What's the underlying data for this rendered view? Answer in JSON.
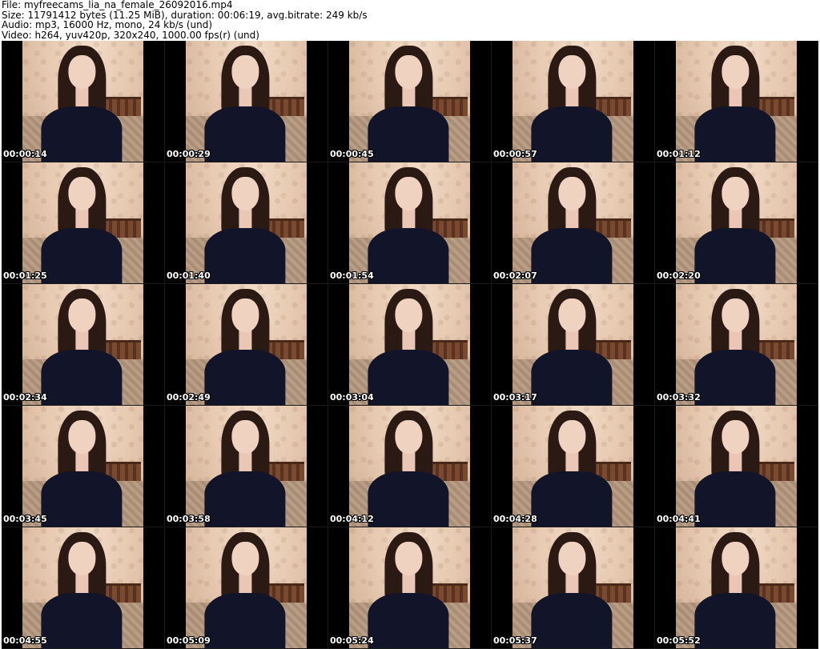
{
  "meta": {
    "file": "File: myfreecams_lia_na_female_26092016.mp4",
    "size": "Size: 11791412 bytes (11.25 MiB), duration: 00:06:19, avg.bitrate: 249 kb/s",
    "audio": "Audio: mp3, 16000 Hz, mono, 24 kb/s (und)",
    "video": "Video: h264, yuv420p, 320x240, 1000.00 fps(r) (und)"
  },
  "thumbnails": [
    {
      "timestamp": "00:00:14"
    },
    {
      "timestamp": "00:00:29"
    },
    {
      "timestamp": "00:00:45"
    },
    {
      "timestamp": "00:00:57"
    },
    {
      "timestamp": "00:01:12"
    },
    {
      "timestamp": "00:01:25"
    },
    {
      "timestamp": "00:01:40"
    },
    {
      "timestamp": "00:01:54"
    },
    {
      "timestamp": "00:02:07"
    },
    {
      "timestamp": "00:02:20"
    },
    {
      "timestamp": "00:02:34"
    },
    {
      "timestamp": "00:02:49"
    },
    {
      "timestamp": "00:03:04"
    },
    {
      "timestamp": "00:03:17"
    },
    {
      "timestamp": "00:03:32"
    },
    {
      "timestamp": "00:03:45"
    },
    {
      "timestamp": "00:03:58"
    },
    {
      "timestamp": "00:04:12"
    },
    {
      "timestamp": "00:04:28"
    },
    {
      "timestamp": "00:04:41"
    },
    {
      "timestamp": "00:04:55"
    },
    {
      "timestamp": "00:05:09"
    },
    {
      "timestamp": "00:05:24"
    },
    {
      "timestamp": "00:05:37"
    },
    {
      "timestamp": "00:05:52"
    }
  ]
}
